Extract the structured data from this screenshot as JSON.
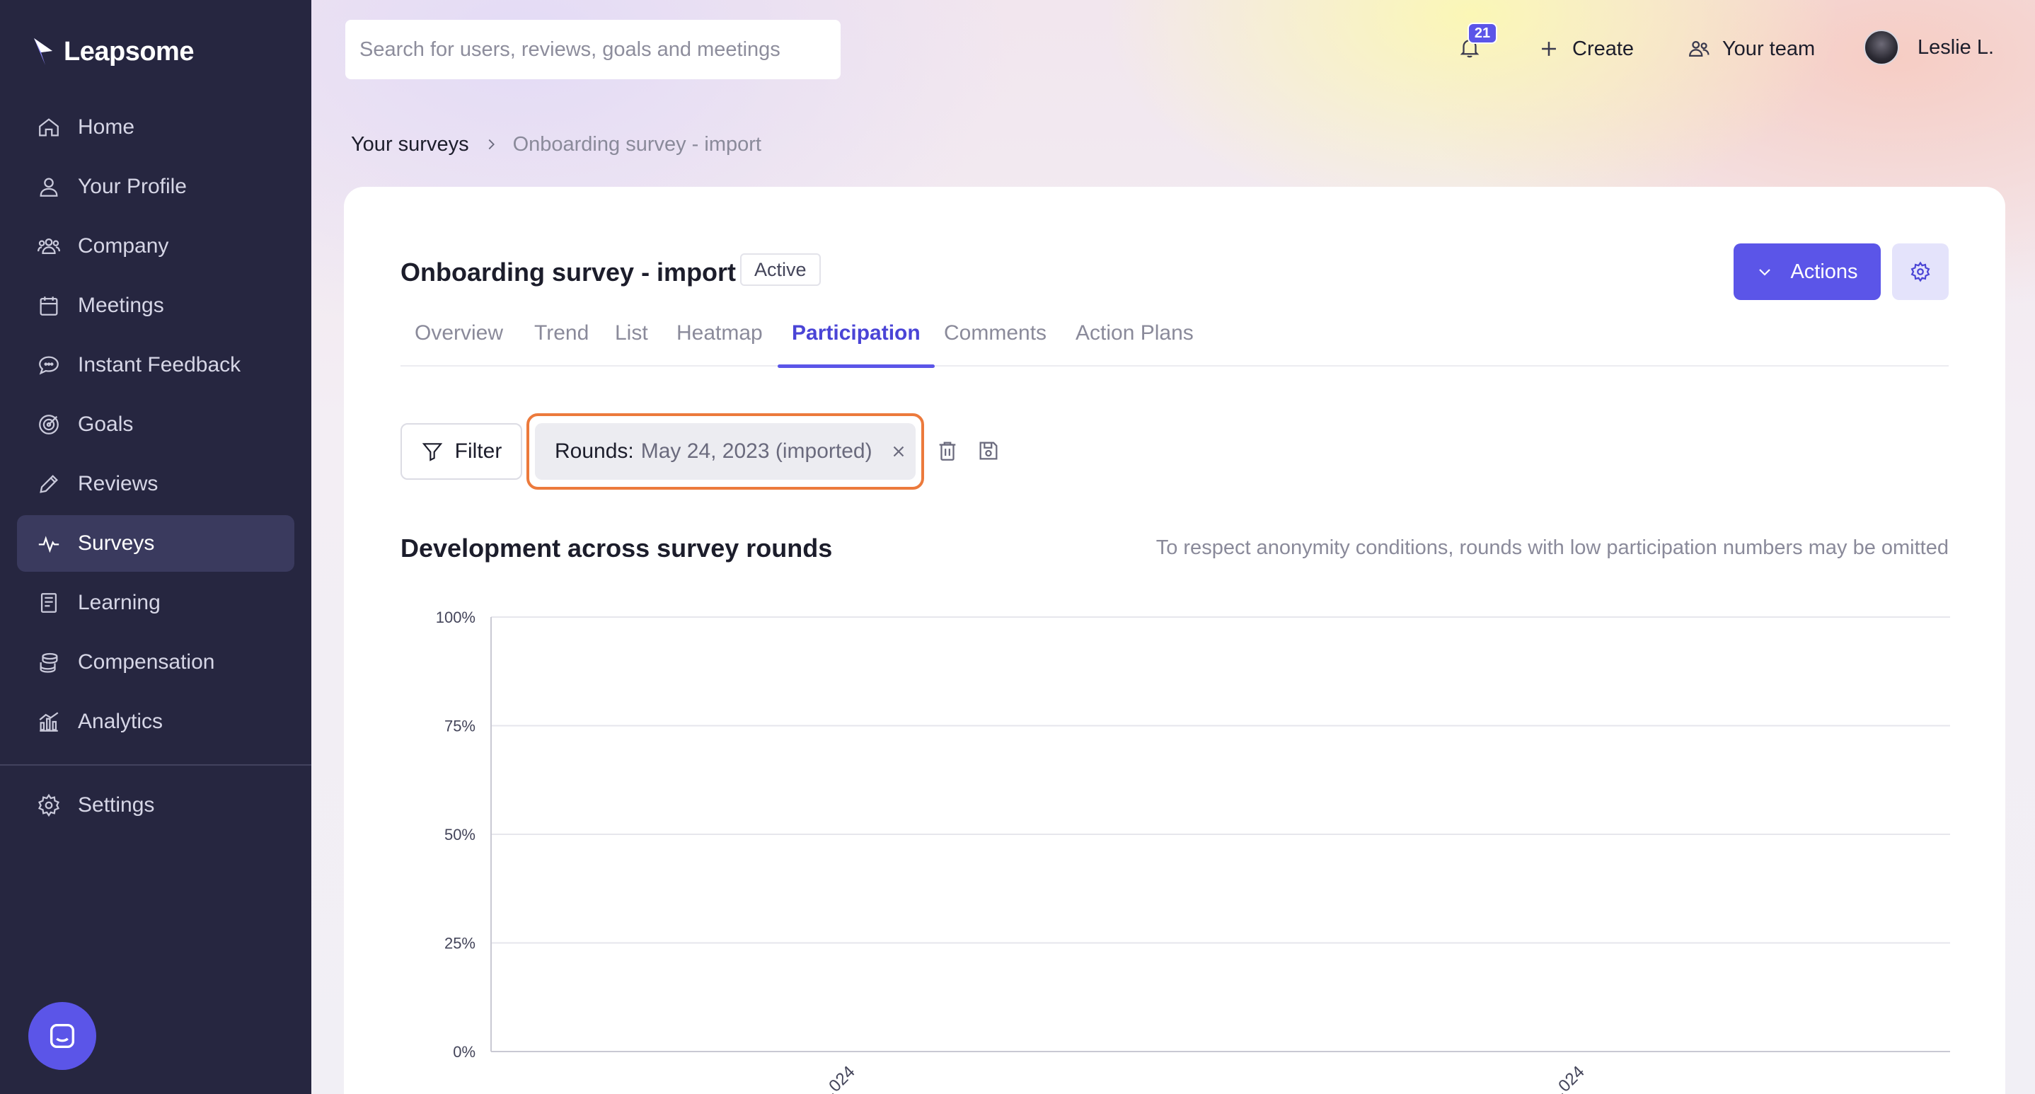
{
  "app": {
    "name": "Leapsome"
  },
  "sidebar": {
    "items": [
      {
        "label": "Home",
        "icon": "home-icon"
      },
      {
        "label": "Your Profile",
        "icon": "user-icon"
      },
      {
        "label": "Company",
        "icon": "people-icon"
      },
      {
        "label": "Meetings",
        "icon": "calendar-icon"
      },
      {
        "label": "Instant Feedback",
        "icon": "chat-bubble-icon"
      },
      {
        "label": "Goals",
        "icon": "target-icon"
      },
      {
        "label": "Reviews",
        "icon": "pencil-icon"
      },
      {
        "label": "Surveys",
        "icon": "pulse-icon",
        "active": true
      },
      {
        "label": "Learning",
        "icon": "book-icon"
      },
      {
        "label": "Compensation",
        "icon": "coins-icon"
      },
      {
        "label": "Analytics",
        "icon": "bar-chart-icon"
      }
    ],
    "settings": {
      "label": "Settings",
      "icon": "gear-icon"
    }
  },
  "topbar": {
    "search_placeholder": "Search for users, reviews, goals and meetings",
    "notifications_count": "21",
    "create_label": "Create",
    "team_label": "Your team",
    "user_name": "Leslie L."
  },
  "breadcrumb": {
    "parent": "Your surveys",
    "current": "Onboarding survey - import"
  },
  "survey": {
    "title": "Onboarding survey - import",
    "status": "Active",
    "actions_label": "Actions"
  },
  "tabs": [
    {
      "label": "Overview"
    },
    {
      "label": "Trend"
    },
    {
      "label": "List"
    },
    {
      "label": "Heatmap"
    },
    {
      "label": "Participation",
      "active": true
    },
    {
      "label": "Comments"
    },
    {
      "label": "Action Plans"
    }
  ],
  "filters": {
    "filter_label": "Filter",
    "chip_key": "Rounds:",
    "chip_value": "May 24, 2023 (imported)"
  },
  "section": {
    "title": "Development across survey rounds",
    "note": "To respect anonymity conditions, rounds with low participation numbers may be omitted"
  },
  "colors": {
    "sidebar_bg": "#262640",
    "accent": "#5b55e8",
    "highlight_outline": "#ec7a3c"
  },
  "chart_data": {
    "type": "line",
    "title": "",
    "xlabel": "",
    "ylabel": "",
    "ylim": [
      0,
      100
    ],
    "y_ticks": [
      "0%",
      "25%",
      "50%",
      "75%",
      "100%"
    ],
    "x_tick_labels": [
      "…024",
      "…024"
    ],
    "series": [],
    "grid": true
  }
}
